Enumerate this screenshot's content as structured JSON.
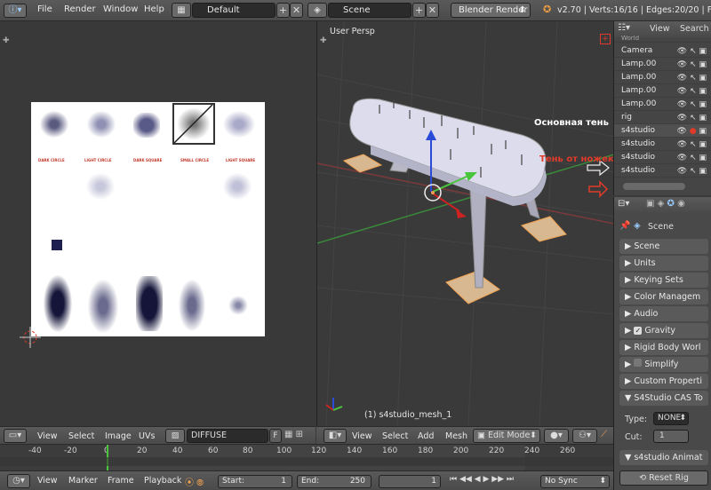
{
  "topbar": {
    "menus": [
      "File",
      "Render",
      "Window",
      "Help"
    ],
    "screen_layout": "Default",
    "scene": "Scene",
    "engine": "Blender Render",
    "stats": "v2.70 | Verts:16/16 | Edges:20/20 | Faces"
  },
  "uv_editor": {
    "texture_labels": [
      "DARK CIRCLE",
      "LIGHT CIRCLE",
      "DARK SQUARE",
      "SMALL CIRCLE",
      "LIGHT SQUARE"
    ],
    "header": {
      "menus": [
        "View",
        "Select",
        "Image",
        "UVs"
      ],
      "image_name": "DIFFUSE",
      "f_label": "F"
    }
  },
  "viewport": {
    "view_label": "User Persp",
    "object_label": "(1) s4studio_mesh_1",
    "annotation_main_shadow": "Основная тень",
    "annotation_leg_shadow": "Тень от ножек",
    "header": {
      "menus": [
        "View",
        "Select",
        "Add",
        "Mesh"
      ],
      "mode": "Edit Mode"
    }
  },
  "outliner": {
    "header_tabs": [
      "View",
      "Search"
    ],
    "partial_top": "World",
    "items": [
      "Camera",
      "Lamp.00",
      "Lamp.00",
      "Lamp.00",
      "Lamp.00",
      "rig",
      "s4studio",
      "s4studio",
      "s4studio",
      "s4studio"
    ]
  },
  "properties": {
    "scene_name": "Scene",
    "panels": [
      "Scene",
      "Units",
      "Keying Sets",
      "Color Managem",
      "Audio",
      "Gravity",
      "Rigid Body Worl",
      "Simplify",
      "Custom Properti",
      "S4Studio CAS To"
    ],
    "type_label": "Type:",
    "type_value": "NONE",
    "cut_label": "Cut:",
    "cut_value": "1",
    "anim_panel": "s4studio Animat",
    "reset_rig": "Reset Rig"
  },
  "timeline": {
    "ticks": [
      "-40",
      "-20",
      "0",
      "20",
      "40",
      "60",
      "80",
      "100",
      "120",
      "140",
      "160",
      "180",
      "200",
      "220",
      "240",
      "260"
    ],
    "header": {
      "menus": [
        "View",
        "Marker",
        "Frame",
        "Playback"
      ],
      "start_label": "Start:",
      "start_value": "1",
      "end_label": "End:",
      "end_value": "250",
      "current_frame": "1",
      "sync": "No Sync"
    }
  },
  "colors": {
    "accent_red": "#e03a2a",
    "axis_green": "#49c53c",
    "axis_blue": "#2a4ad8",
    "selection_orange": "#f0a050"
  }
}
